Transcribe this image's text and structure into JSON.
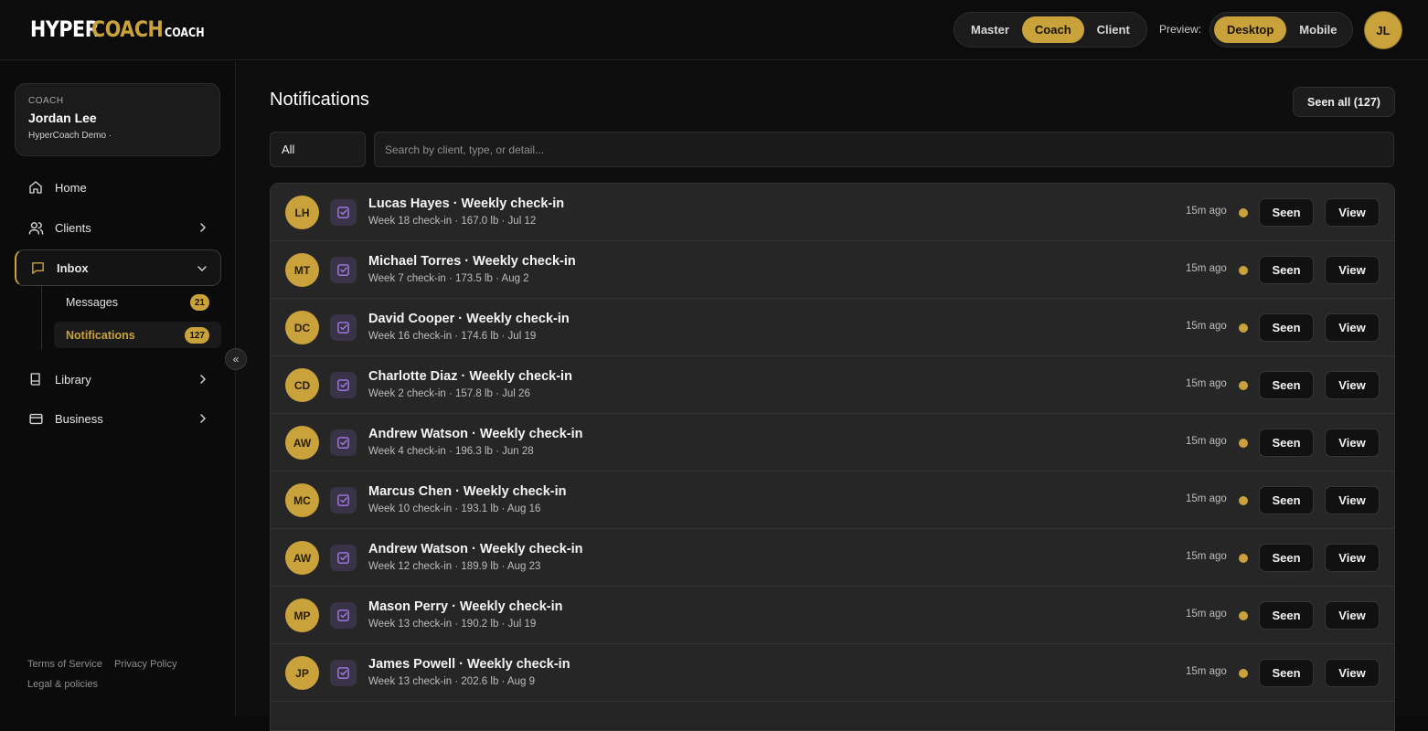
{
  "brand": {
    "part1": "HYPER",
    "part2": "COACH",
    "suffix": "COACH",
    "accent": "#c9a23c"
  },
  "header": {
    "roles": [
      "Master",
      "Coach",
      "Client"
    ],
    "active_role": "Coach",
    "preview_label": "Preview:",
    "devices": [
      "Desktop",
      "Mobile"
    ],
    "active_device": "Desktop",
    "user_initials": "JL"
  },
  "sidebar": {
    "coach_role": "COACH",
    "coach_name": "Jordan Lee",
    "coach_org": "HyperCoach Demo ·",
    "nav": [
      {
        "label": "Home",
        "icon": "home-icon"
      },
      {
        "label": "Clients",
        "icon": "users-icon"
      },
      {
        "label": "Inbox",
        "icon": "chat-icon"
      },
      {
        "label": "Library",
        "icon": "book-icon"
      },
      {
        "label": "Business",
        "icon": "card-icon"
      }
    ],
    "inbox_sub": [
      {
        "label": "Messages",
        "count": "21"
      },
      {
        "label": "Notifications",
        "count": "127"
      }
    ],
    "collapse_glyph": "«",
    "footer": {
      "terms": "Terms of Service",
      "privacy": "Privacy Policy",
      "legal": "Legal & policies"
    }
  },
  "main": {
    "title": "Notifications",
    "seen_all": "Seen all (127)",
    "filter_value": "All",
    "search_placeholder": "Search by client, type, or detail...",
    "seen_label": "Seen",
    "view_label": "View",
    "notifications": [
      {
        "initials": "LH",
        "title": "Lucas Hayes · Weekly check-in",
        "detail": "Week 18 check-in · 167.0 lb · Jul 12",
        "time": "15m ago"
      },
      {
        "initials": "MT",
        "title": "Michael Torres · Weekly check-in",
        "detail": "Week 7 check-in · 173.5 lb · Aug 2",
        "time": "15m ago"
      },
      {
        "initials": "DC",
        "title": "David Cooper · Weekly check-in",
        "detail": "Week 16 check-in · 174.6 lb · Jul 19",
        "time": "15m ago"
      },
      {
        "initials": "CD",
        "title": "Charlotte Diaz · Weekly check-in",
        "detail": "Week 2 check-in · 157.8 lb · Jul 26",
        "time": "15m ago"
      },
      {
        "initials": "AW",
        "title": "Andrew Watson · Weekly check-in",
        "detail": "Week 4 check-in · 196.3 lb · Jun 28",
        "time": "15m ago"
      },
      {
        "initials": "MC",
        "title": "Marcus Chen · Weekly check-in",
        "detail": "Week 10 check-in · 193.1 lb · Aug 16",
        "time": "15m ago"
      },
      {
        "initials": "AW",
        "title": "Andrew Watson · Weekly check-in",
        "detail": "Week 12 check-in · 189.9 lb · Aug 23",
        "time": "15m ago"
      },
      {
        "initials": "MP",
        "title": "Mason Perry · Weekly check-in",
        "detail": "Week 13 check-in · 190.2 lb · Jul 19",
        "time": "15m ago"
      },
      {
        "initials": "JP",
        "title": "James Powell · Weekly check-in",
        "detail": "Week 13 check-in · 202.6 lb · Aug 9",
        "time": "15m ago"
      }
    ]
  }
}
